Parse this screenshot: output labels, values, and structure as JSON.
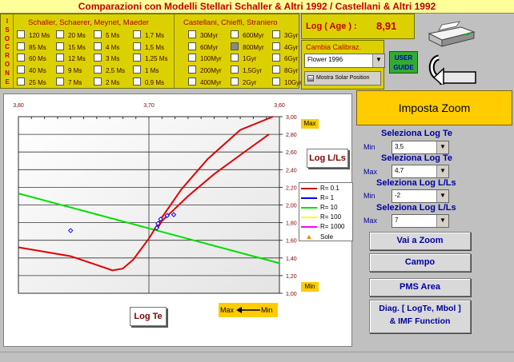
{
  "title": "Comparazioni con Modelli Stellari Schaller & Altri 1992 / Castellani & Altri 1992",
  "isocrone_label": "ISOCRONE",
  "groups": {
    "schaller": {
      "title": "Schaller, Schaerer, Meynet, Maeder",
      "cols": [
        [
          "120 Ms",
          "85 Ms",
          "60 Ms",
          "40 Ms",
          "25 Ms"
        ],
        [
          "20 Ms",
          "15 Ms",
          "12 Ms",
          "9 Ms",
          "7 Ms"
        ],
        [
          "5 Ms",
          "4 Ms",
          "3 Ms",
          "2,5 Ms",
          "2 Ms"
        ],
        [
          "1,7 Ms",
          "1,5 Ms",
          "1,25 Ms",
          "1 Ms",
          "0,9 Ms"
        ]
      ]
    },
    "castellani": {
      "title": "Castellani, Chieffi, Straniero",
      "cols": [
        [
          "30Myr",
          "60Myr",
          "100Myr",
          "200Myr",
          "400Myr"
        ],
        [
          "600Myr",
          "800Myr",
          "1Gyr",
          "1,5Gyr",
          "2Gyr"
        ],
        [
          "3Gyr",
          "4Gyr",
          "6Gyr",
          "8Gyr",
          "10Gyr"
        ]
      ],
      "checked": "800Myr"
    }
  },
  "log_age": {
    "label": "Log ( Age ) :",
    "value": "8,91"
  },
  "calibration": {
    "label": "Cambia Calibraz.",
    "value": "Flower 1996",
    "sun_button": "Mostra Solar Position"
  },
  "user_guide_label": "USER GUIDE",
  "chart_data": {
    "type": "line",
    "xlabel": "Log Te",
    "ylabel": "Log L/Ls",
    "xlim": [
      3.8,
      3.6
    ],
    "ylim": [
      1.0,
      3.0
    ],
    "x_ticks": [
      "3,80",
      "3,70",
      "3,60"
    ],
    "y_ticks": [
      "3,00",
      "2,80",
      "2,60",
      "2,40",
      "2,20",
      "2,00",
      "1,80",
      "1,60",
      "1,40",
      "1,20",
      "1,00"
    ],
    "max_label": "Max",
    "min_label": "Min",
    "axis_arrow": {
      "max": "Max",
      "min": "Min"
    },
    "legend": [
      "R= 0.1",
      "R= 1",
      "R= 10",
      "R= 100",
      "R= 1000",
      "Sole"
    ],
    "series": [
      {
        "name": "R= 10",
        "color": "#00e000",
        "x": [
          3.8,
          3.6
        ],
        "y": [
          2.13,
          1.34
        ]
      },
      {
        "name": "R= 0.1",
        "color": "#e00000",
        "x": [
          3.8,
          3.76,
          3.74,
          3.728,
          3.72,
          3.712,
          3.7,
          3.69,
          3.675,
          3.655,
          3.63,
          3.605
        ],
        "y": [
          1.52,
          1.42,
          1.32,
          1.26,
          1.28,
          1.38,
          1.62,
          1.86,
          2.18,
          2.52,
          2.85,
          3.0
        ]
      },
      {
        "name": "R= 0.1",
        "color": "#e00000",
        "x": [
          3.694,
          3.69,
          3.682,
          3.67,
          3.65,
          3.625,
          3.608
        ],
        "y": [
          1.72,
          1.82,
          1.93,
          2.1,
          2.35,
          2.62,
          2.8
        ]
      }
    ],
    "markers": [
      {
        "x": 3.76,
        "y": 1.71
      },
      {
        "x": 3.694,
        "y": 1.74
      },
      {
        "x": 3.693,
        "y": 1.79
      },
      {
        "x": 3.691,
        "y": 1.84
      },
      {
        "x": 3.686,
        "y": 1.88
      },
      {
        "x": 3.681,
        "y": 1.89
      }
    ],
    "marker_color": "#0000ff"
  },
  "zoom": {
    "header": "Imposta Zoom",
    "te_label": "Seleziona Log Te",
    "te_min": "3,5",
    "te_max": "4,7",
    "ll_label": "Seleziona Log L/Ls",
    "ll_min": "-2",
    "ll_max": "7",
    "min_label": "Min",
    "max_label": "Max"
  },
  "buttons": {
    "vai_zoom": "Vai a Zoom",
    "campo": "Campo",
    "pms": "PMS Area",
    "diag1": "Diag. [ LogTe, Mbol ]",
    "diag2": "& IMF Function"
  }
}
